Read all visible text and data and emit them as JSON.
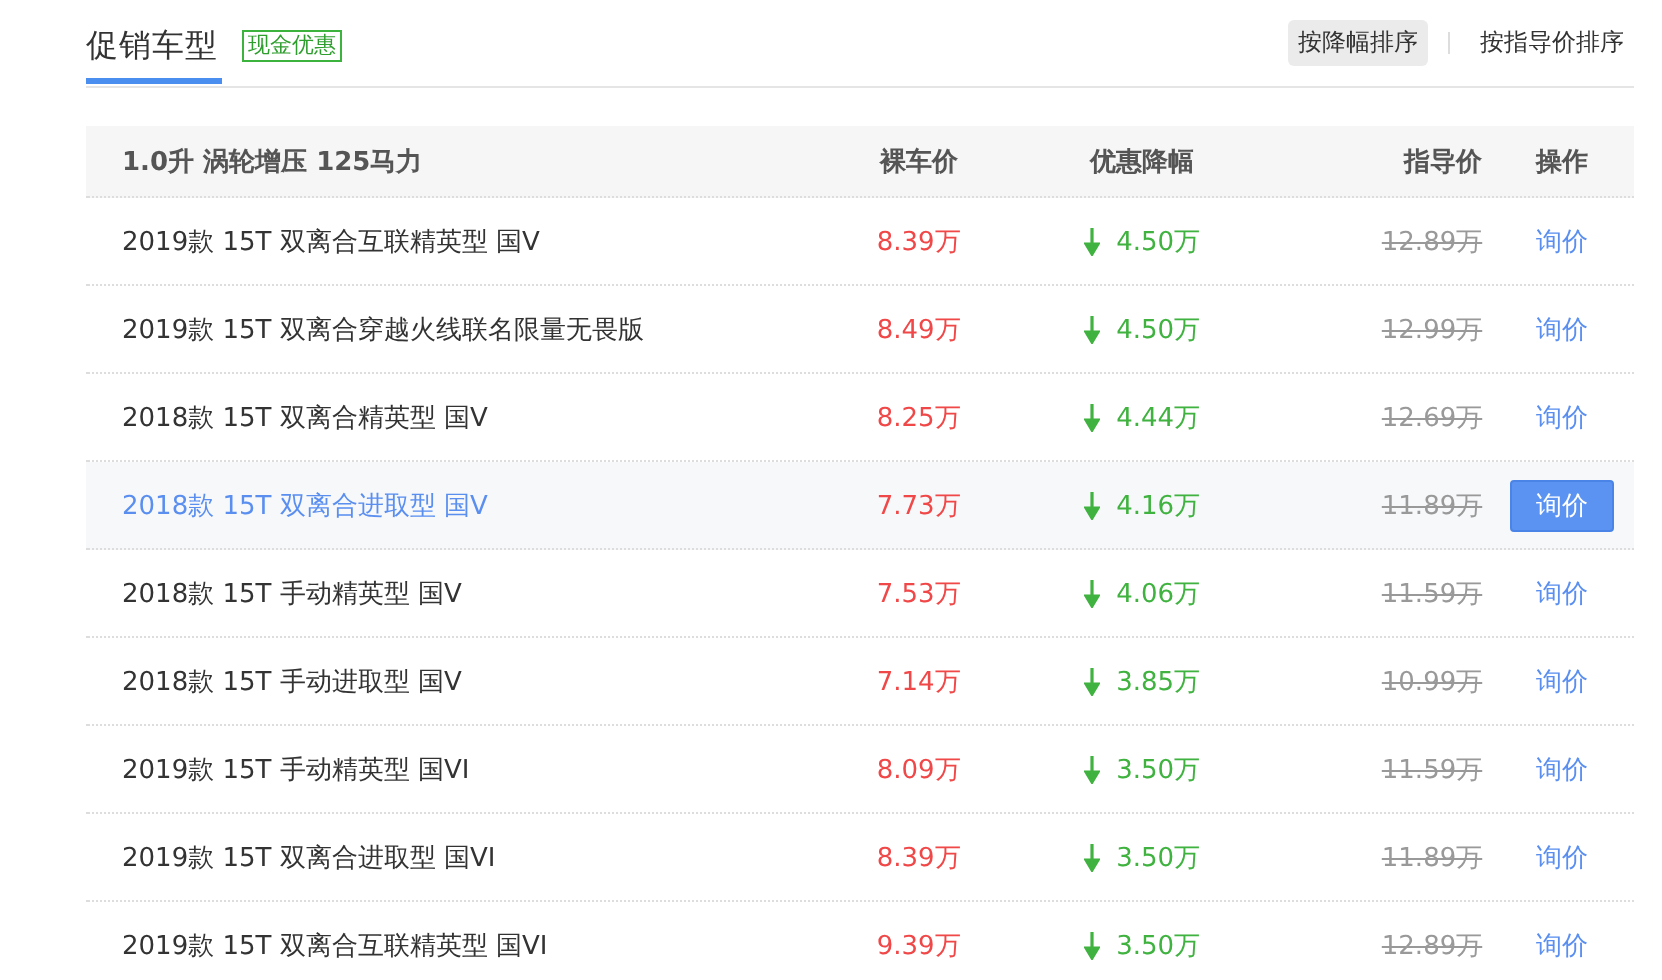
{
  "header": {
    "title": "促销车型",
    "badge": "现金优惠"
  },
  "sort_buttons": [
    {
      "label": "按降幅排序",
      "selected": true
    },
    {
      "label": "按指导价排序",
      "selected": false
    }
  ],
  "table": {
    "columns": [
      "1.0升 涡轮增压 125马力",
      "裸车价",
      "优惠降幅",
      "指导价",
      "操作"
    ],
    "rows": [
      {
        "name": "2019款 15T 双离合互联精英型 国V",
        "price": "8.39万",
        "discount": "4.50万",
        "msrp": "12.89万",
        "action": "询价",
        "selected": false
      },
      {
        "name": "2019款 15T 双离合穿越火线联名限量无畏版",
        "price": "8.49万",
        "discount": "4.50万",
        "msrp": "12.99万",
        "action": "询价",
        "selected": false
      },
      {
        "name": "2018款 15T 双离合精英型 国V",
        "price": "8.25万",
        "discount": "4.44万",
        "msrp": "12.69万",
        "action": "询价",
        "selected": false
      },
      {
        "name": "2018款 15T 双离合进取型 国V",
        "price": "7.73万",
        "discount": "4.16万",
        "msrp": "11.89万",
        "action": "询价",
        "selected": true
      },
      {
        "name": "2018款 15T 手动精英型 国V",
        "price": "7.53万",
        "discount": "4.06万",
        "msrp": "11.59万",
        "action": "询价",
        "selected": false
      },
      {
        "name": "2018款 15T 手动进取型 国V",
        "price": "7.14万",
        "discount": "3.85万",
        "msrp": "10.99万",
        "action": "询价",
        "selected": false
      },
      {
        "name": "2019款 15T 手动精英型 国VI",
        "price": "8.09万",
        "discount": "3.50万",
        "msrp": "11.59万",
        "action": "询价",
        "selected": false
      },
      {
        "name": "2019款 15T 双离合进取型 国VI",
        "price": "8.39万",
        "discount": "3.50万",
        "msrp": "11.89万",
        "action": "询价",
        "selected": false
      },
      {
        "name": "2019款 15T 双离合互联精英型 国VI",
        "price": "9.39万",
        "discount": "3.50万",
        "msrp": "12.89万",
        "action": "询价",
        "selected": false
      }
    ]
  }
}
